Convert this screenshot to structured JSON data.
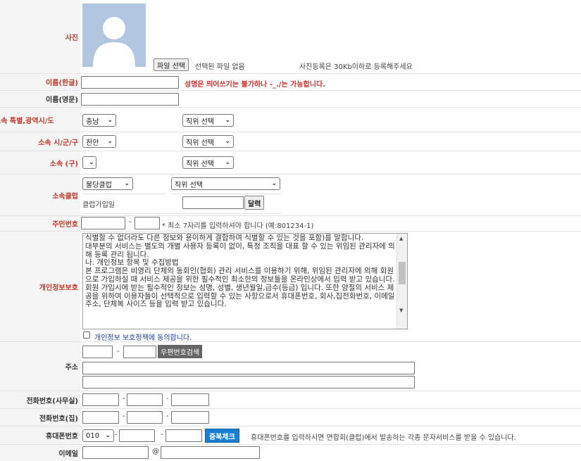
{
  "photo": {
    "label": "사진",
    "file_button": "파일 선택",
    "no_file": "선택된 파일 없음",
    "note": "사진등록은 30Kb이하로 등록해주세요",
    "avatar_icon": "person-silhouette-icon"
  },
  "name_kr": {
    "label": "이름(한글)",
    "value": "",
    "note": "성명은 띄어쓰기는 불가하나 -_./는 가능합니다."
  },
  "name_en": {
    "label": "이름(영문)",
    "value": ""
  },
  "province": {
    "label": "소속 특별,광역시/도",
    "select": "충남",
    "position": "직위 선택"
  },
  "city": {
    "label": "소속 시/군/구",
    "select": "천안",
    "position": "직위 선택"
  },
  "district": {
    "label": "소속 (구)",
    "select": "",
    "position": "직위 선택"
  },
  "club": {
    "label": "소속클럽",
    "select": "불당클럽",
    "position": "직위 선택",
    "join_label": "클럽가입일",
    "calendar_button": "달력"
  },
  "resident": {
    "label": "주민번호",
    "note": "* 최소 7자리를 입력하셔야 합니다 (예:801234-1)"
  },
  "privacy": {
    "label": "개인정보보호",
    "text": "식별할 수 없더라도 다른 정보와 용이하게 결합하여 식별할 수 있는 것을 포함)를 말합니다.\n대부분의 서비스는 별도의 개별 사용자 등록이 없이, 특정 조직을 대표 할 수 있는 위임된 관리자에 의해 등록 관리 됩니다.\n나. 개인정보 항목 및 수집방법\n본 프로그램은 비영리 단체의 동회인(협회) 관리 서비스를 이용하기 위해, 위임된 관리자에 의해 회원으로 가입하실 때 서비스 제공을 위한 필수적인 최소한의 정보들을 온라인상에서 입력 받고 있습니다. 회원 가입시에 받는 필수적인 정보는 성명, 성별, 생년월일,급수(등급) 입니다. 또한 양질의 서비스 제공을 위하여 이용자들이 선택적으로 입력할 수 있는 사항으로서 휴대폰번호, 회사,집전화번호, 이메일주소, 단체복 사이즈 등을 입력 받고 있습니다.",
    "agree": "개인정보 보호정책에 동의합니다."
  },
  "address": {
    "label": "주소",
    "zip_button": "우편번호검색"
  },
  "phone_office": {
    "label": "전화번호(사무실)"
  },
  "phone_home": {
    "label": "전화번호(집)"
  },
  "mobile": {
    "label": "휴대폰번호",
    "prefix": "010",
    "dup_button": "중복체크",
    "note": "휴대폰번호를 입력하시면 연합회(클럽)에서 발송하는 각종 문자서비스를 받을 수 있습니다."
  },
  "email": {
    "label": "이메일",
    "at": "@"
  },
  "colors": {
    "label_red": "#c0392b",
    "dup_button_bg": "#1b7fd1",
    "zip_button_bg": "#666666"
  }
}
